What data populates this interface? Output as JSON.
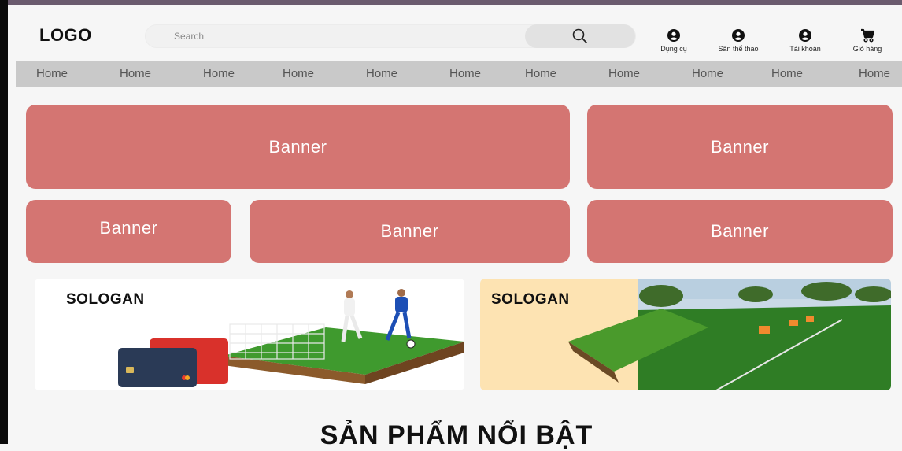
{
  "header": {
    "logo": "LOGO",
    "search_placeholder": "Search",
    "actions": [
      {
        "label": "Dụng cụ",
        "icon": "user-circle-icon"
      },
      {
        "label": "Sân thể thao",
        "icon": "user-circle-icon"
      },
      {
        "label": "Tài khoản",
        "icon": "user-circle-icon"
      },
      {
        "label": "Giỏ hàng",
        "icon": "cart-icon"
      }
    ]
  },
  "nav": {
    "items": [
      "Home",
      "Home",
      "Home",
      "Home",
      "Home",
      "Home",
      "Home",
      "Home",
      "Home",
      "Home",
      "Home"
    ]
  },
  "banners": [
    "Banner",
    "Banner",
    "Banner",
    "Banner",
    "Banner"
  ],
  "promos": [
    {
      "slogan": "SOLOGAN"
    },
    {
      "slogan": "SOLOGAN"
    }
  ],
  "section": {
    "title": "SẢN PHẨM NỔI BẬT"
  },
  "colors": {
    "banner": "#d47572",
    "nav_bar": "#c9c9c9",
    "promo2_bg": "#fde3b2"
  }
}
